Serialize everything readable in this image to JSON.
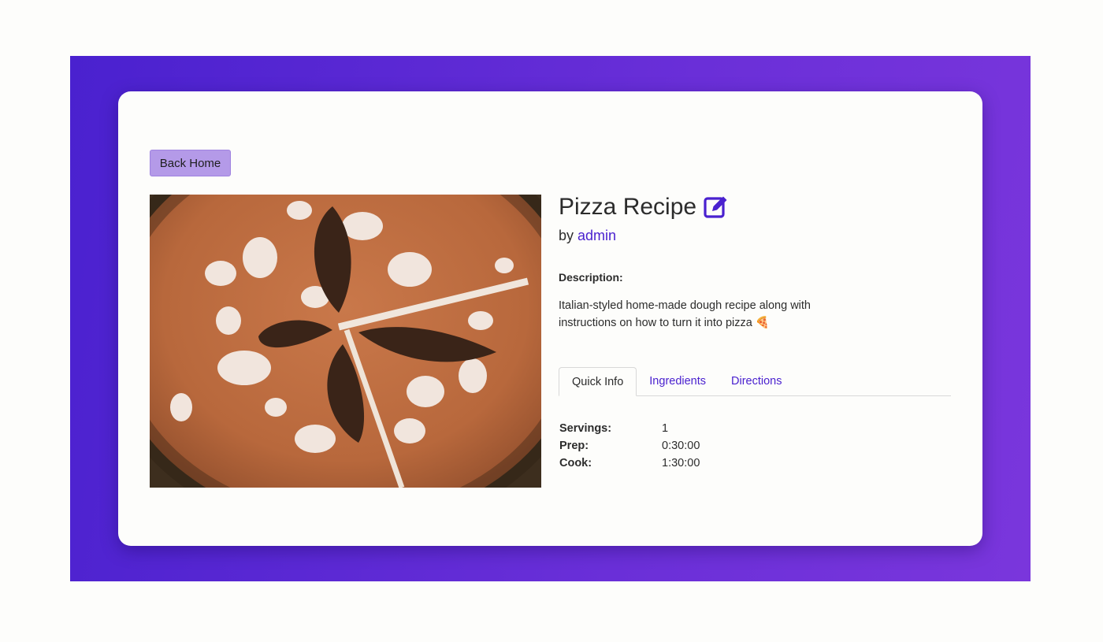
{
  "back_button": {
    "label": "Back Home"
  },
  "recipe": {
    "title": "Pizza Recipe",
    "by_prefix": "by",
    "author": "admin",
    "description_label": "Description:",
    "description": "Italian-styled home-made dough recipe along with instructions on how to turn it into pizza 🍕"
  },
  "tabs": [
    {
      "label": "Quick Info",
      "active": true
    },
    {
      "label": "Ingredients",
      "active": false
    },
    {
      "label": "Directions",
      "active": false
    }
  ],
  "quick_info": [
    {
      "label": "Servings:",
      "value": "1"
    },
    {
      "label": "Prep:",
      "value": "0:30:00"
    },
    {
      "label": "Cook:",
      "value": "1:30:00"
    }
  ],
  "icons": {
    "edit": "edit-pencil-icon"
  },
  "colors": {
    "accent": "#4a21cf",
    "button_bg": "#b49ae8",
    "frame_gradient_start": "#4a21cf",
    "frame_gradient_end": "#7a36dc"
  }
}
